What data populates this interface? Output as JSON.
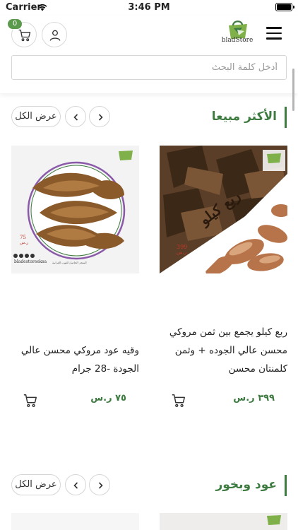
{
  "status_bar": {
    "carrier": "Carrier",
    "time": "3:46 PM"
  },
  "header": {
    "cart_count": "0",
    "logo_text": "bladStore",
    "search_placeholder": "أدخل كلمة البحث"
  },
  "sections": [
    {
      "title": "الأكثر مبيعا",
      "view_all": "عرض الكل",
      "products": [
        {
          "name": "ربع كيلو يجمع بين ثمن مروكي محسن عالي الجوده + وثمن كلمنتان محسن",
          "price": "٣٩٩ ر.س",
          "image_caption": "ربع كيلو",
          "image_price": "399",
          "image_currency": "ر.س"
        },
        {
          "name": "وقيه عود مروكي محسن عالي الجودة -28 جرام",
          "price": "٧٥ ر.س",
          "image_price": "75",
          "image_currency": "ر.س",
          "image_handle": "bladestoreeksa",
          "image_footer": "المتجر الحاصل للثوب الغرابية"
        }
      ]
    },
    {
      "title": "عود وبخور",
      "view_all": "عرض الكل",
      "products": []
    }
  ],
  "colors": {
    "accent": "#3e7b40",
    "badge": "#5b9a4c"
  }
}
